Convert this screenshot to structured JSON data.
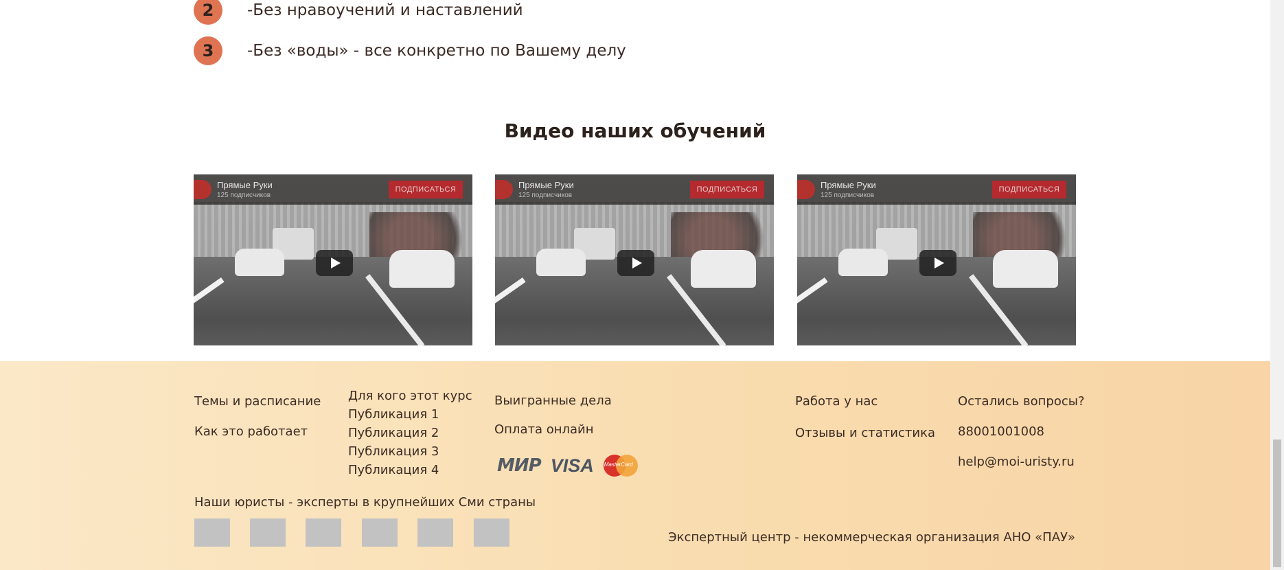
{
  "benefits": [
    {
      "num": "2",
      "text": "-Без нравоучений и наставлений"
    },
    {
      "num": "3",
      "text": "-Без «воды» - все конкретно по Вашему делу"
    }
  ],
  "videos_section": {
    "title": "Видео наших обучений",
    "videos": [
      {
        "channel": "Прямые Руки",
        "subs": "125 подписчиков",
        "subscribe": "ПОДПИСАТЬСЯ"
      },
      {
        "channel": "Прямые Руки",
        "subs": "125 подписчиков",
        "subscribe": "ПОДПИСАТЬСЯ"
      },
      {
        "channel": "Прямые Руки",
        "subs": "125 подписчиков",
        "subscribe": "ПОДПИСАТЬСЯ"
      }
    ]
  },
  "footer": {
    "col1": [
      "Темы и расписание",
      "Как это работает"
    ],
    "col2": [
      "Для кого этот курс",
      "Публикация 1",
      "Публикация 2",
      "Публикация 3",
      "Публикация 4"
    ],
    "col3": [
      "Выигранные дела",
      "Оплата онлайн"
    ],
    "payment": {
      "mir": "МИР",
      "visa": "VISA",
      "mastercard": "MasterCard"
    },
    "col4": [
      "Работа у нас",
      "Отзывы и статистика"
    ],
    "contacts": {
      "question": "Остались вопросы?",
      "phone": "88001001008",
      "email": "help@moi-uristy.ru"
    },
    "media_title": "Наши юристы - эксперты в крупнейших Сми страны",
    "org": "Экспертный центр - некоммерческая организация АНО «ПАУ»"
  }
}
